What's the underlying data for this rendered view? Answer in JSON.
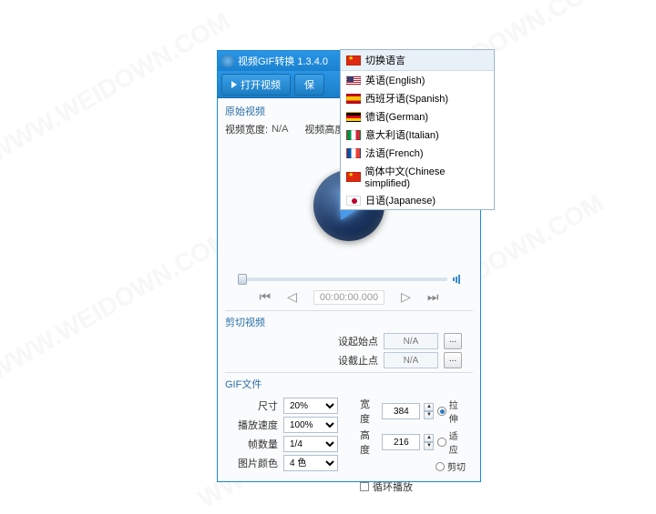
{
  "window": {
    "title": "视频GIF转换 1.3.4.0",
    "minimize": "—",
    "maximize": "❐",
    "close": "✕"
  },
  "toolbar": {
    "open_label": "打开视频",
    "save_label": "保"
  },
  "source": {
    "group": "原始视频",
    "width_label": "视频宽度:",
    "width_value": "N/A",
    "height_label": "视频高度:"
  },
  "transport": {
    "timecode": "00:00:00.000"
  },
  "cut": {
    "group": "剪切视频",
    "start_label": "设起始点",
    "start_value": "N/A",
    "end_label": "设截止点",
    "end_value": "N/A",
    "dots": "..."
  },
  "gif": {
    "group": "GIF文件",
    "size_label": "尺寸",
    "size_value": "20%",
    "speed_label": "播放速度",
    "speed_value": "100%",
    "frames_label": "帧数量",
    "frames_value": "1/4",
    "colors_label": "图片颜色",
    "colors_value": "4 色",
    "width_label": "宽度",
    "width_value": "384",
    "height_label": "高度",
    "height_value": "216",
    "stretch": "拉伸",
    "fit": "适应",
    "crop": "剪切",
    "loop": "循环播放"
  },
  "lang": {
    "header": "切换语言",
    "items": [
      {
        "flag": "us",
        "label": "英语(English)"
      },
      {
        "flag": "es",
        "label": "西班牙语(Spanish)"
      },
      {
        "flag": "de",
        "label": "德语(German)"
      },
      {
        "flag": "it",
        "label": "意大利语(Italian)"
      },
      {
        "flag": "fr",
        "label": "法语(French)"
      },
      {
        "flag": "cn",
        "label": "简体中文(Chinese simplified)"
      },
      {
        "flag": "jp",
        "label": "日语(Japanese)"
      }
    ]
  }
}
